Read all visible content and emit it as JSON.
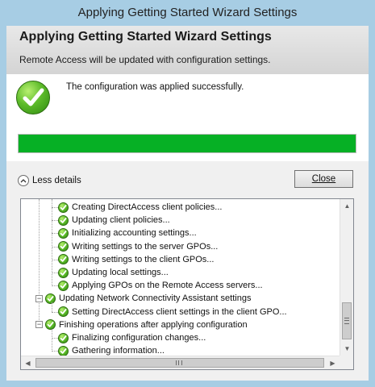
{
  "window": {
    "title": "Applying Getting Started Wizard Settings"
  },
  "header": {
    "title": "Applying Getting Started Wizard Settings",
    "subtitle": "Remote Access will be updated with configuration settings."
  },
  "status": {
    "message": "The configuration was applied successfully.",
    "progress": 1.0,
    "progress_color": "#06b025"
  },
  "details_toggle": {
    "label": "Less details",
    "icon": "chevron-up-icon"
  },
  "close_button": {
    "label": "Close"
  },
  "tree": {
    "items": [
      {
        "level": 1,
        "label": "Creating DirectAccess client policies..."
      },
      {
        "level": 1,
        "label": "Updating client policies..."
      },
      {
        "level": 1,
        "label": "Initializing accounting settings..."
      },
      {
        "level": 1,
        "label": "Writing settings to the server GPOs..."
      },
      {
        "level": 1,
        "label": "Writing settings to the client GPOs..."
      },
      {
        "level": 1,
        "label": "Updating local settings..."
      },
      {
        "level": 1,
        "label": "Applying GPOs on the Remote Access servers..."
      },
      {
        "level": 0,
        "label": "Updating Network Connectivity Assistant settings"
      },
      {
        "level": 1,
        "label": "Setting DirectAccess client settings in the client GPO..."
      },
      {
        "level": 0,
        "label": "Finishing operations after applying configuration"
      },
      {
        "level": 1,
        "label": "Finalizing configuration changes..."
      },
      {
        "level": 1,
        "label": "Gathering information..."
      }
    ]
  },
  "colors": {
    "accent": "#06b025",
    "frame": "#a7cde4",
    "check": "#5dbb2a"
  }
}
